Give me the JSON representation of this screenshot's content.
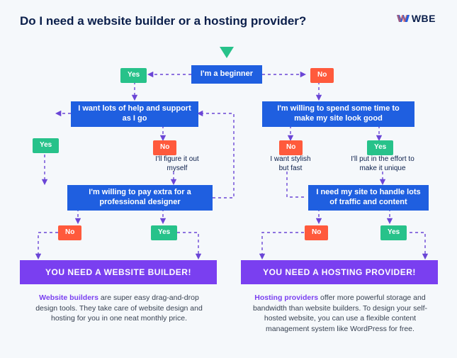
{
  "title": "Do I need a website builder or a hosting provider?",
  "brand": "WBE",
  "labels": {
    "yes": "Yes",
    "no": "No"
  },
  "nodes": {
    "beginner": "I'm a beginner",
    "help": "I want lots of help and support as I go",
    "spend": "I'm willing to spend some time to make my site look good",
    "figure": "I'll figure it out myself",
    "stylish": "I want stylish but fast",
    "effort": "I'll put in the effort to make it unique",
    "payextra": "I'm willing to pay extra for a professional designer",
    "traffic": "I need my site to handle lots of traffic and content",
    "builder": "YOU NEED A WEBSITE BUILDER!",
    "hosting": "YOU NEED A HOSTING PROVIDER!"
  },
  "descriptions": {
    "builder_lead": "Website builders",
    "builder": " are super easy drag-and-drop design tools. They take care of website design and hosting for you in one neat monthly price.",
    "hosting_lead": "Hosting providers",
    "hosting": " offer more powerful storage and bandwidth than website builders. To design your self-hosted website, you can use a flexible content management system like WordPress for free."
  }
}
